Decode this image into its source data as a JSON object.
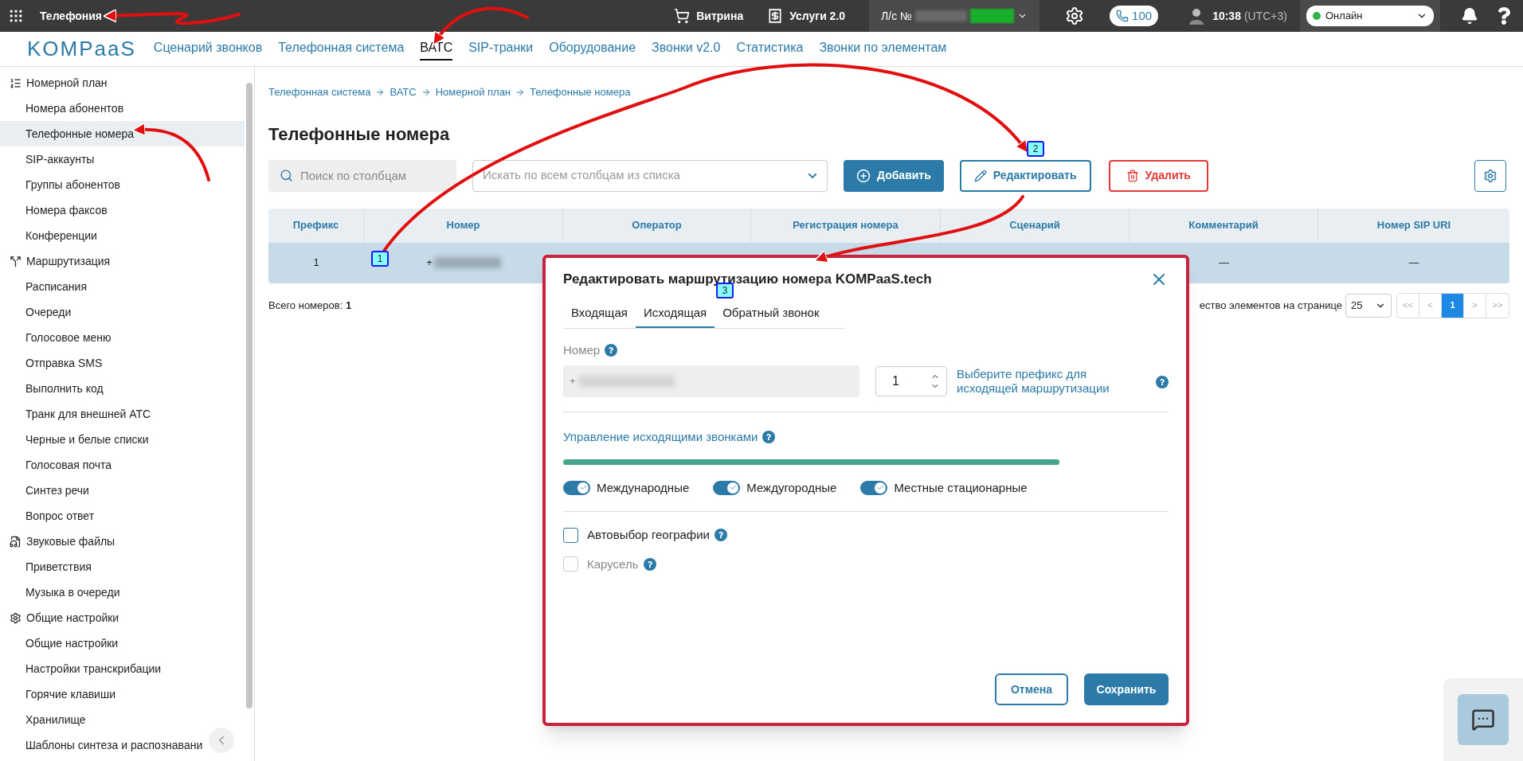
{
  "top_bar": {
    "app_title": "Телефония",
    "links": [
      {
        "label": "Витрина"
      },
      {
        "label": "Услуги 2.0"
      }
    ],
    "account": {
      "label": "Л/с №"
    },
    "calls": "100",
    "time": "10:38",
    "timezone": "(UTC+3)",
    "status": {
      "label": "Онлайн"
    }
  },
  "nav": {
    "logo": "KOMPaaS",
    "tabs": [
      {
        "label": "Сценарий звонков",
        "selected": false
      },
      {
        "label": "Телефонная система",
        "selected": false
      },
      {
        "label": "ВАТС",
        "selected": true
      },
      {
        "label": "SIP-транки",
        "selected": false
      },
      {
        "label": "Оборудование",
        "selected": false
      },
      {
        "label": "Звонки v2.0",
        "selected": false
      },
      {
        "label": "Статистика",
        "selected": false
      },
      {
        "label": "Звонки по элементам",
        "selected": false
      }
    ]
  },
  "sidebar": {
    "sections": [
      {
        "title": "Номерной план",
        "items": [
          {
            "label": "Номера абонентов",
            "selected": false
          },
          {
            "label": "Телефонные номера",
            "selected": true
          },
          {
            "label": "SIP-аккаунты",
            "selected": false
          },
          {
            "label": "Группы абонентов",
            "selected": false
          },
          {
            "label": "Номера факсов",
            "selected": false
          },
          {
            "label": "Конференции",
            "selected": false
          }
        ]
      },
      {
        "title": "Маршрутизация",
        "items": [
          {
            "label": "Расписания",
            "selected": false
          },
          {
            "label": "Очереди",
            "selected": false
          },
          {
            "label": "Голосовое меню",
            "selected": false
          },
          {
            "label": "Отправка SMS",
            "selected": false
          },
          {
            "label": "Выполнить код",
            "selected": false
          },
          {
            "label": "Транк для внешней АТС",
            "selected": false
          },
          {
            "label": "Черные и белые списки",
            "selected": false
          },
          {
            "label": "Голосовая почта",
            "selected": false
          },
          {
            "label": "Синтез речи",
            "selected": false
          },
          {
            "label": "Вопрос ответ",
            "selected": false
          }
        ]
      },
      {
        "title": "Звуковые файлы",
        "items": [
          {
            "label": "Приветствия",
            "selected": false
          },
          {
            "label": "Музыка в очереди",
            "selected": false
          }
        ]
      },
      {
        "title": "Общие настройки",
        "items": [
          {
            "label": "Общие настройки",
            "selected": false
          },
          {
            "label": "Настройки транскрибации",
            "selected": false
          },
          {
            "label": "Горячие клавиши",
            "selected": false
          },
          {
            "label": "Хранилище",
            "selected": false
          },
          {
            "label": "Шаблоны синтеза и распознавани",
            "selected": false
          }
        ]
      }
    ]
  },
  "breadcrumbs": [
    "Телефонная система",
    "ВАТС",
    "Номерной план",
    "Телефонные номера"
  ],
  "page_title": "Телефонные номера",
  "toolbar": {
    "search": {
      "placeholder": "Поиск по столбцам"
    },
    "column_select": {
      "placeholder": "Искать по всем столбцам из списка"
    },
    "add": "Добавить",
    "edit": "Редактировать",
    "delete": "Удалить"
  },
  "table": {
    "columns": [
      "Префикс",
      "Номер",
      "Оператор",
      "Регистрация номера",
      "Сценарий",
      "Комментарий",
      "Номер SIP URI"
    ],
    "rows": [
      {
        "prefix": "1",
        "number": "+",
        "comment": "—",
        "sip_uri": "—",
        "selected": true
      }
    ]
  },
  "footer": {
    "total_label": "Всего номеров:",
    "total": "1",
    "page_size_label": "ество элементов на странице",
    "page_size": "25",
    "pager": [
      {
        "label": "<<",
        "selected": false
      },
      {
        "label": "<",
        "selected": false
      },
      {
        "label": "1",
        "selected": true
      },
      {
        "label": ">",
        "selected": false
      },
      {
        "label": ">>",
        "selected": false
      }
    ]
  },
  "dialog": {
    "title": "Редактировать маршрутизацию номера KOMPaaS.tech",
    "tabs": [
      {
        "label": "Входящая",
        "selected": false
      },
      {
        "label": "Исходящая",
        "selected": true
      },
      {
        "label": "Обратный звонок",
        "selected": false
      }
    ],
    "number": {
      "label": "Номер",
      "value": "+"
    },
    "prefix": {
      "value": "1"
    },
    "prefix_hint": "Выберите префикс для исходящей маршрутизации",
    "calls_section": {
      "title": "Управление исходящими звонками",
      "level": 1
    },
    "toggles": [
      {
        "label": "Международные",
        "on": true
      },
      {
        "label": "Междугородные",
        "on": true
      },
      {
        "label": "Местные стационарные",
        "on": true
      }
    ],
    "checkboxes": [
      {
        "label": "Автовыбор географии",
        "checked": false,
        "disabled": false
      },
      {
        "label": "Карусель",
        "checked": false,
        "disabled": true
      }
    ],
    "cancel": "Отмена",
    "save": "Сохранить"
  },
  "annotations": [
    {
      "label": "1"
    },
    {
      "label": "2"
    },
    {
      "label": "3"
    }
  ]
}
